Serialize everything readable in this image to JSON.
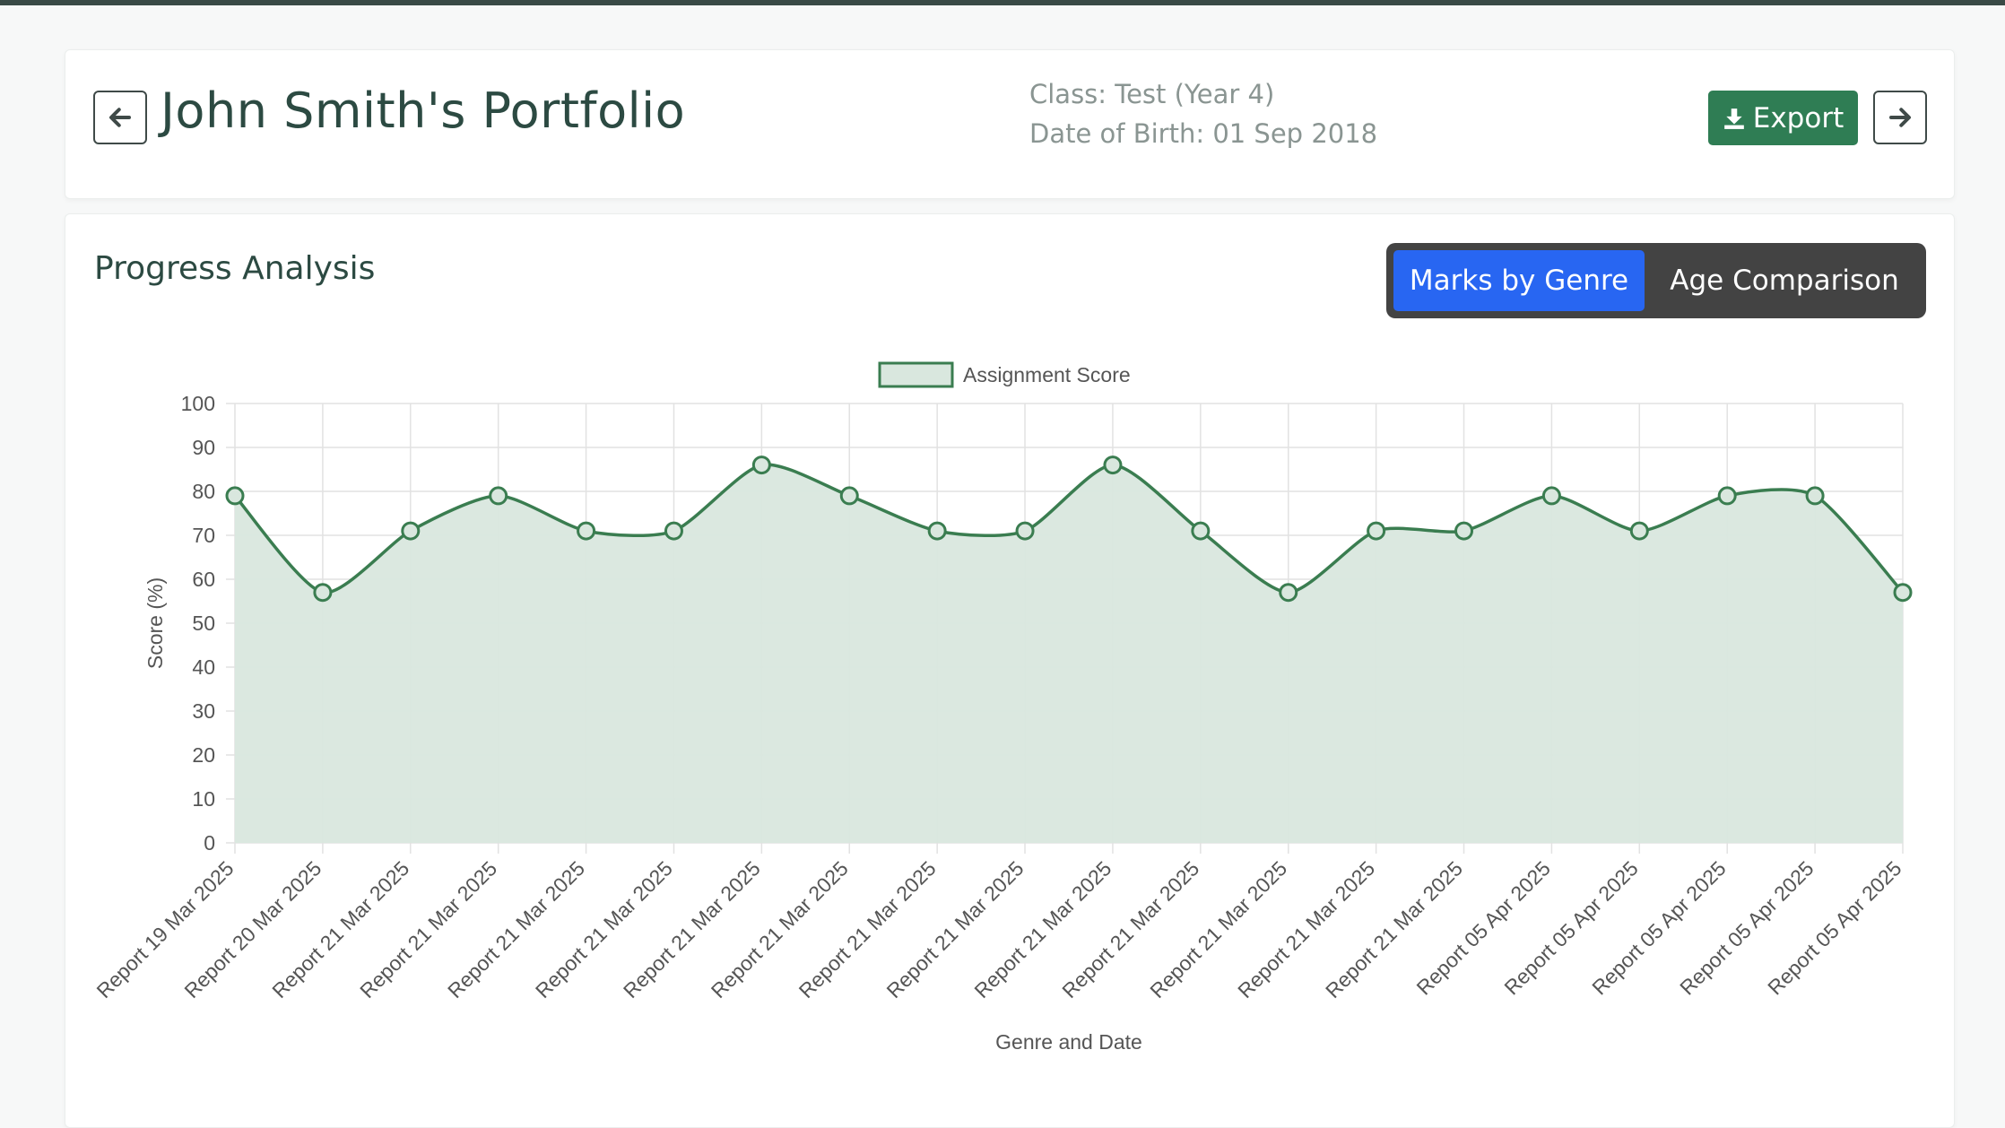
{
  "header": {
    "title": "John Smith's Portfolio",
    "class_line": "Class: Test (Year 4)",
    "dob_line": "Date of Birth: 01 Sep 2018",
    "export_label": "Export",
    "back_icon": "arrow-left-icon",
    "next_icon": "arrow-right-icon",
    "export_icon": "download-icon"
  },
  "section": {
    "title": "Progress Analysis",
    "tabs": [
      {
        "label": "Marks by Genre",
        "active": true
      },
      {
        "label": "Age Comparison",
        "active": false
      }
    ]
  },
  "colors": {
    "brand_green": "#2f7d54",
    "line_green": "#3a7d50",
    "fill_green": "#d9e7de",
    "active_tab": "#2866f2"
  },
  "chart_data": {
    "type": "area",
    "legend": "Assignment Score",
    "legend_position": "top-center",
    "xlabel": "Genre and Date",
    "ylabel": "Score (%)",
    "ylim": [
      0,
      100
    ],
    "ytick_step": 10,
    "grid": true,
    "categories": [
      "Report 19 Mar 2025",
      "Report 20 Mar 2025",
      "Report 21 Mar 2025",
      "Report 21 Mar 2025",
      "Report 21 Mar 2025",
      "Report 21 Mar 2025",
      "Report 21 Mar 2025",
      "Report 21 Mar 2025",
      "Report 21 Mar 2025",
      "Report 21 Mar 2025",
      "Report 21 Mar 2025",
      "Report 21 Mar 2025",
      "Report 21 Mar 2025",
      "Report 21 Mar 2025",
      "Report 21 Mar 2025",
      "Report 05 Apr 2025",
      "Report 05 Apr 2025",
      "Report 05 Apr 2025",
      "Report 05 Apr 2025",
      "Report 05 Apr 2025"
    ],
    "series": [
      {
        "name": "Assignment Score",
        "values": [
          79,
          57,
          71,
          79,
          71,
          71,
          86,
          79,
          71,
          71,
          86,
          71,
          57,
          71,
          71,
          79,
          71,
          79,
          79,
          57
        ]
      }
    ]
  }
}
